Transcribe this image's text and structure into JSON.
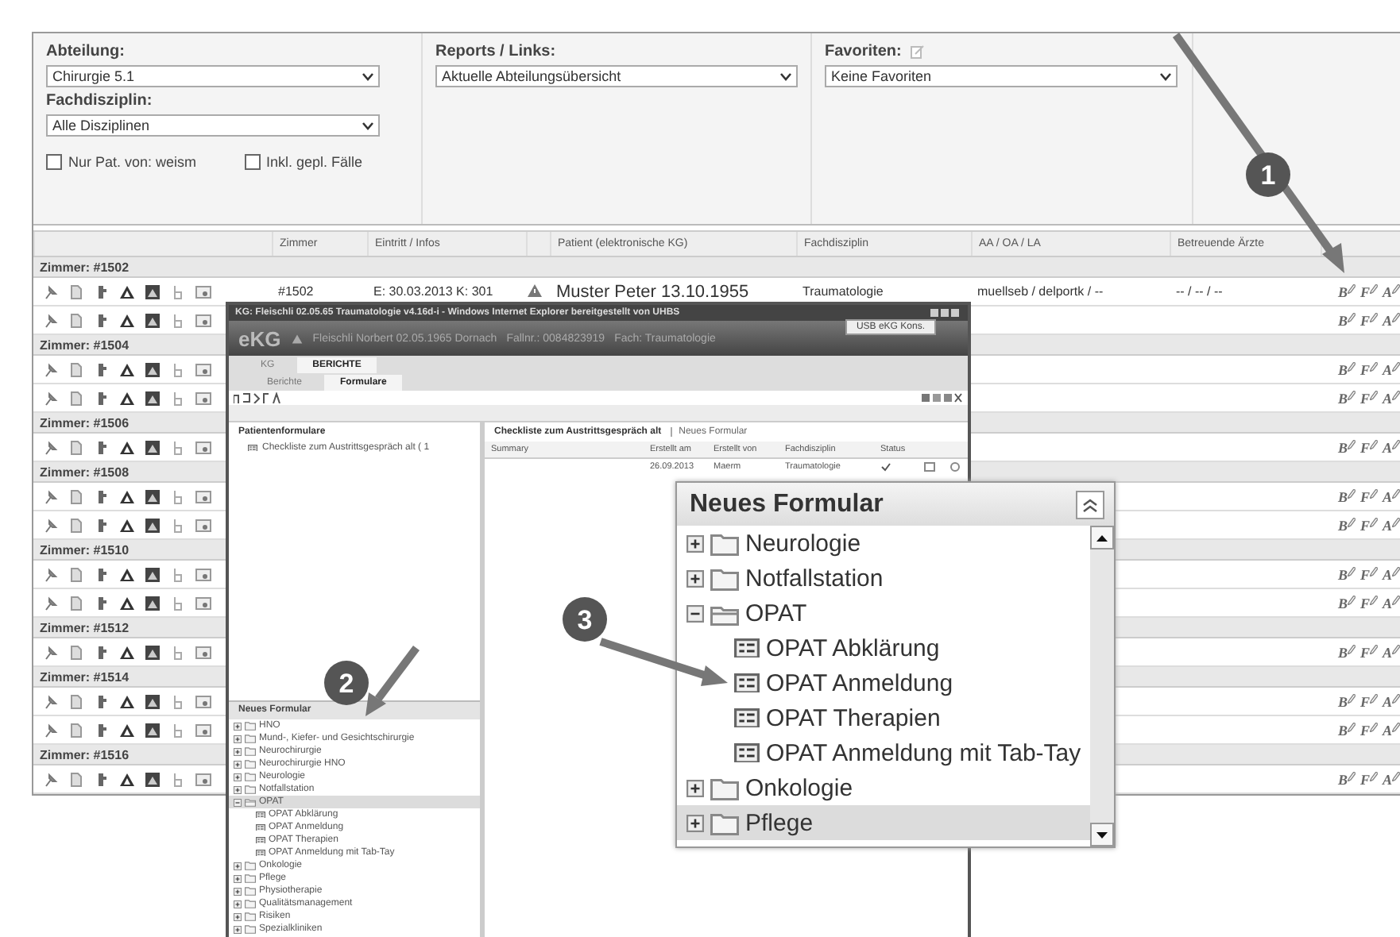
{
  "filters": {
    "department": {
      "label": "Abteilung:",
      "value": "Chirurgie 5.1"
    },
    "discipline": {
      "label": "Fachdisziplin:",
      "value": "Alle Disziplinen"
    },
    "checkboxes": [
      {
        "label": "Nur Pat. von: weism",
        "checked": false
      },
      {
        "label": "Inkl. gepl. Fälle",
        "checked": false
      }
    ],
    "reports": {
      "label": "Reports / Links:",
      "value": "Aktuelle Abteilungsübersicht"
    },
    "favorites": {
      "label": "Favoriten:",
      "value": "Keine Favoriten"
    }
  },
  "table": {
    "columns": [
      "Zimmer",
      "Eintritt / Infos",
      "Patient (elektronische KG)",
      "Fachdisziplin",
      "AA / OA / LA",
      "Betreuende Ärzte"
    ],
    "groups": [
      {
        "title": "Zimmer: #1502",
        "rows": [
          {
            "room": "#1502",
            "admission": "E: 30.03.2013 K: 301",
            "warning": true,
            "patient": "Muster Peter 13.10.1955",
            "discipline": "Traumatologie",
            "staff": "muellseb / delportk / --",
            "doctors": "-- / -- / --",
            "actions": [
              "B",
              "F",
              "A"
            ]
          },
          {
            "actions": [
              "B",
              "F",
              "A"
            ]
          }
        ]
      },
      {
        "title": "Zimmer: #1504",
        "rows": [
          {
            "actions": [
              "B",
              "F",
              "A"
            ]
          },
          {
            "actions": [
              "B",
              "F",
              "A"
            ]
          }
        ]
      },
      {
        "title": "Zimmer: #1506",
        "rows": [
          {
            "actions": [
              "B",
              "F",
              "A"
            ]
          }
        ]
      },
      {
        "title": "Zimmer: #1508",
        "rows": [
          {
            "actions": [
              "B",
              "F",
              "A"
            ]
          },
          {
            "actions": [
              "B",
              "F",
              "A"
            ]
          }
        ]
      },
      {
        "title": "Zimmer: #1510",
        "rows": [
          {
            "actions": [
              "B",
              "F",
              "A"
            ]
          },
          {
            "actions": [
              "B",
              "F",
              "A"
            ]
          }
        ]
      },
      {
        "title": "Zimmer: #1512",
        "rows": [
          {
            "actions": [
              "B",
              "F",
              "A"
            ]
          }
        ]
      },
      {
        "title": "Zimmer: #1514",
        "rows": [
          {
            "actions": [
              "B",
              "F",
              "A"
            ]
          },
          {
            "actions": [
              "B",
              "F",
              "A"
            ]
          }
        ]
      },
      {
        "title": "Zimmer: #1516",
        "rows": [
          {
            "actions": [
              "B",
              "F",
              "A"
            ]
          }
        ]
      }
    ]
  },
  "popup": {
    "title": "KG: Fleischli 02.05.65 Traumatologie v4.16d-i - Windows Internet Explorer bereitgestellt von UHBS",
    "tooltip": "USB eKG Kons.",
    "app_name": "eKG",
    "patient": "Fleischli Norbert 02.05.1965 Dornach",
    "case": "Fallnr.: 0084823919",
    "field": "Fach: Traumatologie",
    "tabs": [
      {
        "label": "KG",
        "selected": false
      },
      {
        "label": "BERICHTE",
        "selected": true
      }
    ],
    "subtabs": [
      {
        "label": "Berichte",
        "selected": false
      },
      {
        "label": "Formulare",
        "selected": true
      }
    ],
    "left_panel": {
      "title": "Patientenformulare",
      "items": [
        "Checkliste zum Austrittsgespräch alt ( 1"
      ]
    },
    "main_panel": {
      "title": "Checkliste zum Austrittsgespräch alt",
      "new_button": "Neues Formular",
      "columns": [
        "Summary",
        "Erstellt am",
        "Erstellt von",
        "Fachdisziplin",
        "Status"
      ],
      "rows": [
        {
          "created": "26.09.2013",
          "author": "Maerm",
          "discipline": "Traumatologie",
          "done": true
        }
      ]
    },
    "new_form": {
      "title": "Neues Formular",
      "items": [
        {
          "label": "HNO",
          "kind": "folder",
          "expanded": false,
          "selected": false
        },
        {
          "label": "Mund-, Kiefer- und Gesichtschirurgie",
          "kind": "folder",
          "expanded": false,
          "selected": false
        },
        {
          "label": "Neurochirurgie",
          "kind": "folder",
          "expanded": false,
          "selected": false
        },
        {
          "label": "Neurochirurgie HNO",
          "kind": "folder",
          "expanded": false,
          "selected": false
        },
        {
          "label": "Neurologie",
          "kind": "folder",
          "expanded": false,
          "selected": false
        },
        {
          "label": "Notfallstation",
          "kind": "folder",
          "expanded": false,
          "selected": false
        },
        {
          "label": "OPAT",
          "kind": "folder",
          "expanded": true,
          "selected": true,
          "children": [
            {
              "label": "OPAT Abklärung",
              "kind": "form",
              "selected": false
            },
            {
              "label": "OPAT Anmeldung",
              "kind": "form",
              "selected": false
            },
            {
              "label": "OPAT Therapien",
              "kind": "form",
              "selected": false
            },
            {
              "label": "OPAT Anmeldung mit Tab-Tay",
              "kind": "form",
              "selected": false
            }
          ]
        },
        {
          "label": "Onkologie",
          "kind": "folder",
          "expanded": false,
          "selected": false
        },
        {
          "label": "Pflege",
          "kind": "folder",
          "expanded": false,
          "selected": false
        },
        {
          "label": "Physiotherapie",
          "kind": "folder",
          "expanded": false,
          "selected": false
        },
        {
          "label": "Qualitätsmanagement",
          "kind": "folder",
          "expanded": false,
          "selected": false
        },
        {
          "label": "Risiken",
          "kind": "folder",
          "expanded": false,
          "selected": false
        },
        {
          "label": "Spezialkliniken",
          "kind": "folder",
          "expanded": false,
          "selected": false
        }
      ]
    }
  },
  "zoom_panel": {
    "title": "Neues Formular",
    "items": [
      {
        "label": "Neurologie",
        "kind": "folder",
        "expanded": false,
        "selected": false
      },
      {
        "label": "Notfallstation",
        "kind": "folder",
        "expanded": false,
        "selected": false
      },
      {
        "label": "OPAT",
        "kind": "folder",
        "expanded": true,
        "selected": false,
        "children": [
          {
            "label": "OPAT Abklärung",
            "kind": "form",
            "selected": false
          },
          {
            "label": "OPAT Anmeldung",
            "kind": "form",
            "selected": false
          },
          {
            "label": "OPAT Therapien",
            "kind": "form",
            "selected": false
          },
          {
            "label": "OPAT Anmeldung mit Tab-Tay",
            "kind": "form",
            "selected": false
          }
        ]
      },
      {
        "label": "Onkologie",
        "kind": "folder",
        "expanded": false,
        "selected": false
      },
      {
        "label": "Pflege",
        "kind": "folder",
        "expanded": false,
        "selected": true
      }
    ]
  },
  "annotations": [
    "1",
    "2",
    "3"
  ]
}
